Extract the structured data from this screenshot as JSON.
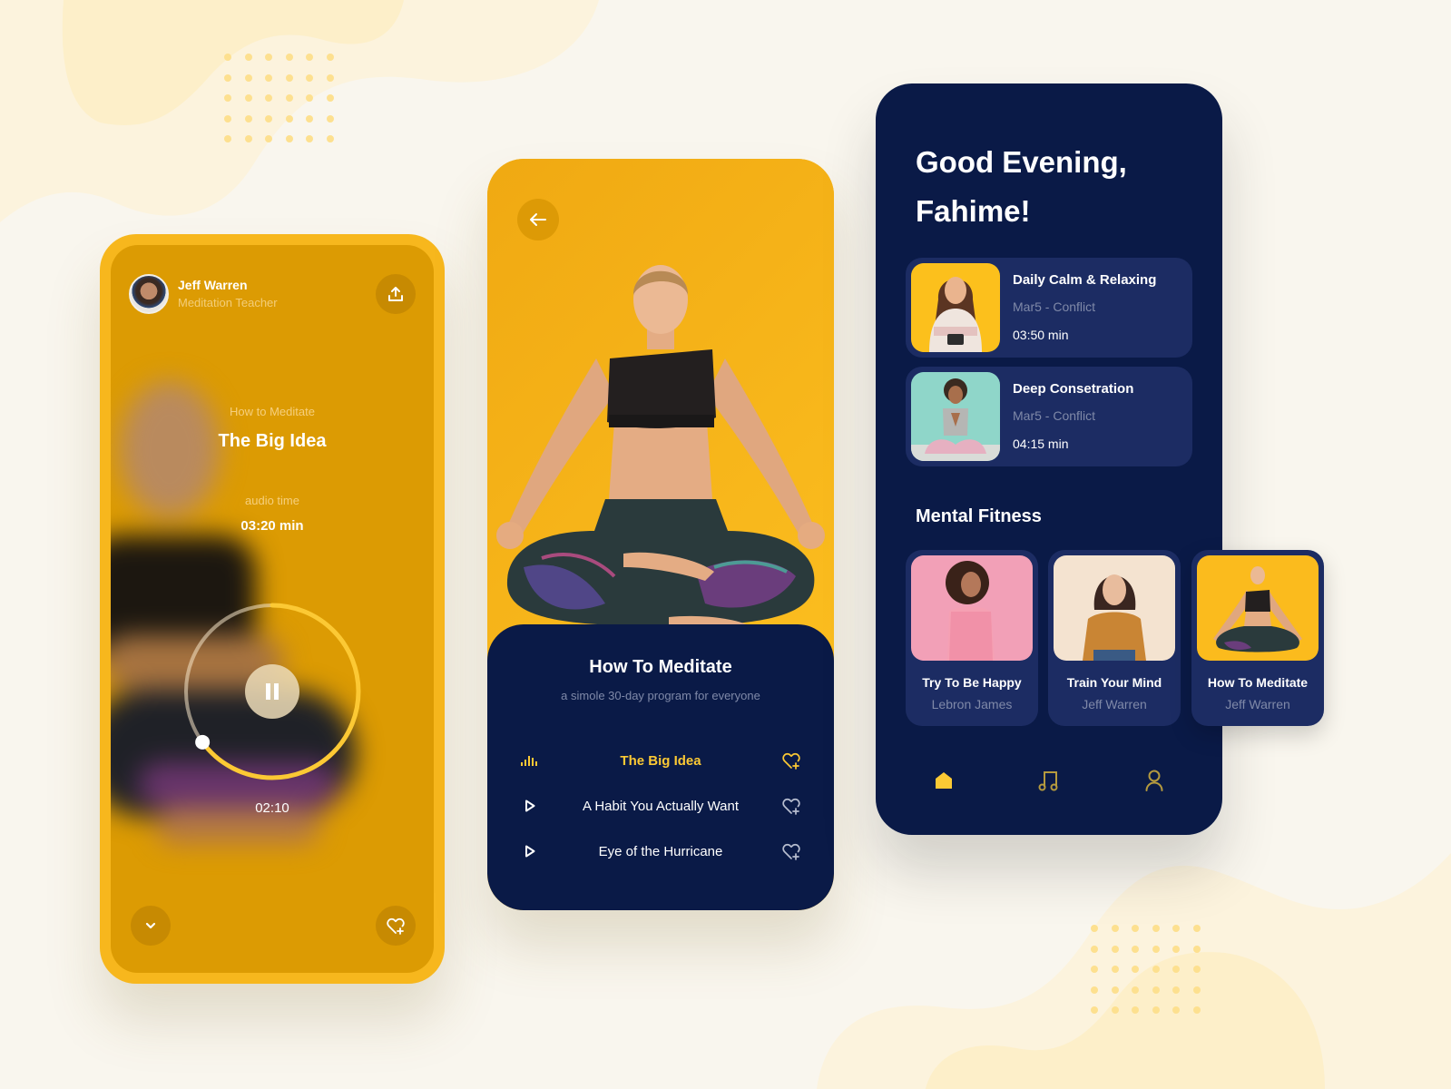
{
  "colors": {
    "accent_yellow": "#fcc934",
    "amber": "#f7b71d",
    "amber_dark": "#dc9b03",
    "navy": "#0a1a47",
    "navy_card": "#1c2c63",
    "muted_text": "#7f89a8",
    "background": "#f9f6ee"
  },
  "player": {
    "teacher_name": "Jeff Warren",
    "teacher_role": "Meditation Teacher",
    "series": "How to Meditate",
    "track_title": "The Big Idea",
    "audio_time_label": "audio time",
    "audio_time_value": "03:20 min",
    "elapsed": "02:10",
    "progress_fraction": 0.65,
    "icons": {
      "share": "share-upload-icon",
      "play_state": "pause-icon",
      "collapse": "chevron-down-icon",
      "favorite": "heart-plus-icon"
    }
  },
  "program": {
    "title": "How To Meditate",
    "subtitle": "a simole 30-day program for everyone",
    "episodes": [
      {
        "title": "The Big Idea",
        "state": "playing",
        "lead_icon": "equalizer-icon"
      },
      {
        "title": "A Habit You Actually Want",
        "state": "idle",
        "lead_icon": "play-icon"
      },
      {
        "title": "Eye of the Hurricane",
        "state": "idle",
        "lead_icon": "play-icon"
      }
    ]
  },
  "home": {
    "greeting_line1": "Good Evening,",
    "greeting_line2": "Fahime!",
    "sessions": [
      {
        "title": "Daily Calm & Relaxing",
        "subtitle": "Mar5 - Conflict",
        "duration": "03:50 min"
      },
      {
        "title": "Deep Consetration",
        "subtitle": "Mar5 - Conflict",
        "duration": "04:15 min"
      }
    ],
    "section_title": "Mental Fitness",
    "cards": [
      {
        "title": "Try To Be Happy",
        "author": "Lebron James"
      },
      {
        "title": "Train Your Mind",
        "author": "Jeff Warren"
      },
      {
        "title": "How To Meditate",
        "author": "Jeff Warren"
      }
    ],
    "nav": [
      {
        "name": "home",
        "active": true
      },
      {
        "name": "music",
        "active": false
      },
      {
        "name": "profile",
        "active": false
      }
    ]
  }
}
